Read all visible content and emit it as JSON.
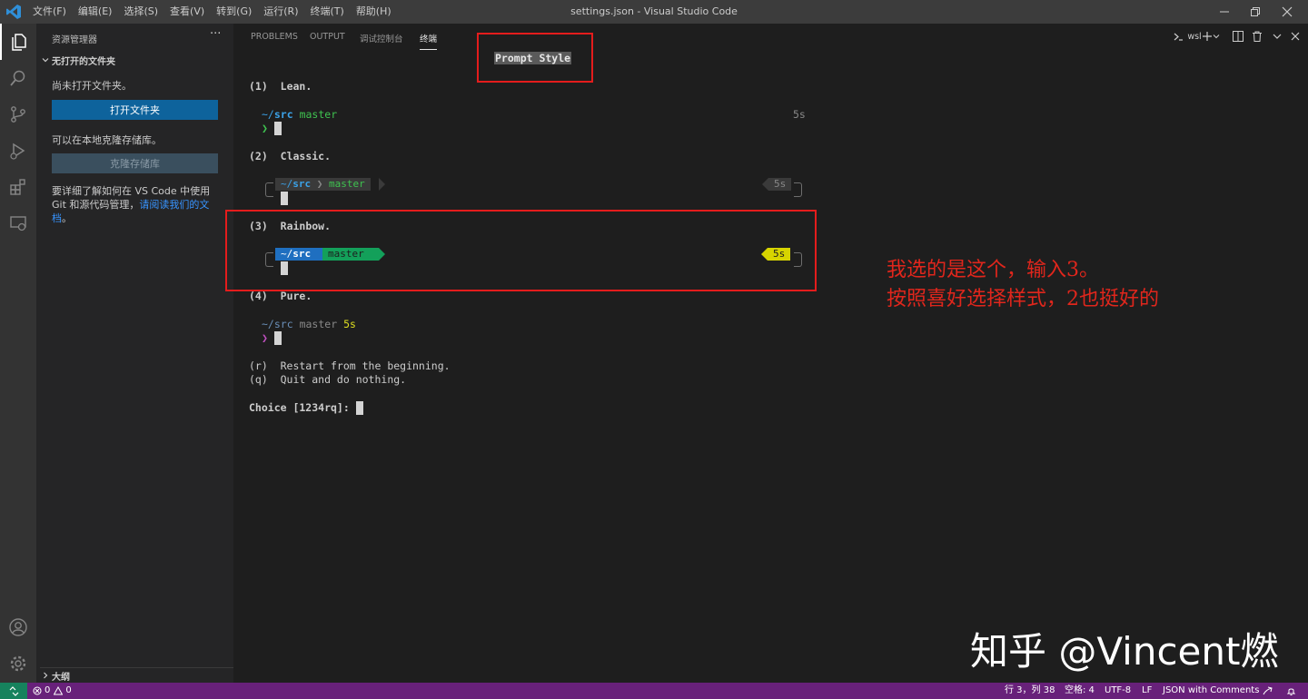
{
  "window": {
    "title": "settings.json - Visual Studio Code",
    "menu": [
      "文件(F)",
      "编辑(E)",
      "选择(S)",
      "查看(V)",
      "转到(G)",
      "运行(R)",
      "终端(T)",
      "帮助(H)"
    ]
  },
  "sidebar": {
    "header": "资源管理器",
    "more": "···",
    "section_title": "无打开的文件夹",
    "no_folder_text": "尚未打开文件夹。",
    "open_folder_button": "打开文件夹",
    "clone_hint": "可以在本地克隆存储库。",
    "clone_button": "克隆存储库",
    "doc_text": "要详细了解如何在 VS Code 中使用 Git 和源代码管理，",
    "doc_link": "请阅读我们的文档",
    "doc_end": "。",
    "outline": "大纲"
  },
  "panel": {
    "tabs": [
      "PROBLEMS",
      "OUTPUT",
      "调试控制台",
      "终端"
    ],
    "active_tab": "终端",
    "terminal_name": "wsl"
  },
  "terminal": {
    "heading": "Prompt Style",
    "options": [
      {
        "num": "(1)",
        "name": "Lean."
      },
      {
        "num": "(2)",
        "name": "Classic."
      },
      {
        "num": "(3)",
        "name": "Rainbow."
      },
      {
        "num": "(4)",
        "name": "Pure."
      }
    ],
    "prompt_dir_prefix": "~/",
    "prompt_dir": "src",
    "prompt_branch": "master",
    "prompt_time": "5s",
    "prompt_char": "❯",
    "restart_line": "(r)  Restart from the beginning.",
    "quit_line": "(q)  Quit and do nothing.",
    "choice_prompt": "Choice [1234rq]:"
  },
  "annotation": {
    "line1": "我选的是这个，输入3。",
    "line2": "按照喜好选择样式，2也挺好的"
  },
  "watermark": "知乎 @Vincent燃",
  "statusbar": {
    "errors": "0",
    "warnings": "0",
    "position": "行 3，列 38",
    "spaces": "空格: 4",
    "encoding": "UTF-8",
    "eol": "LF",
    "language": "JSON with Comments"
  },
  "colors": {
    "accent": "#0e639c",
    "statusbar": "#68217a",
    "annotation": "#e41c1c",
    "rainbow_dir": "#1f6fc0",
    "rainbow_branch": "#13a05a",
    "rainbow_time": "#d7d400"
  }
}
